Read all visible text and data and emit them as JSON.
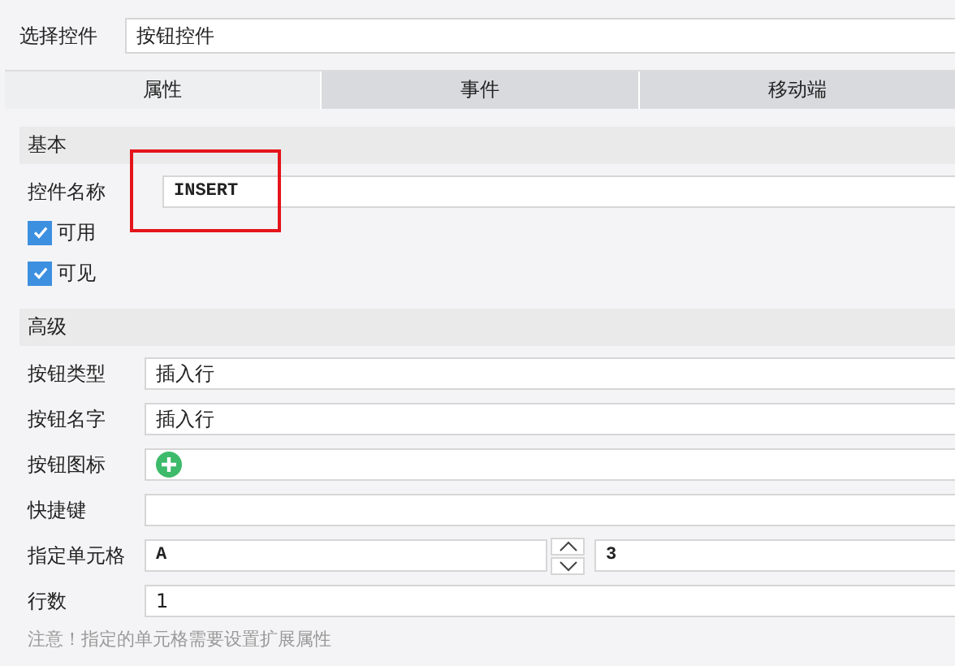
{
  "selector": {
    "label": "选择控件",
    "value": "按钮控件"
  },
  "tabs": [
    {
      "label": "属性",
      "selected": true
    },
    {
      "label": "事件",
      "selected": false
    },
    {
      "label": "移动端",
      "selected": false
    }
  ],
  "sections": [
    {
      "title": "基本",
      "rows": [
        {
          "kind": "text",
          "label": "控件名称",
          "value": "INSERT",
          "highlighted": true,
          "mono": true
        },
        {
          "kind": "checkbox",
          "label": "可用",
          "checked": true
        },
        {
          "kind": "checkbox",
          "label": "可见",
          "checked": true
        }
      ]
    },
    {
      "title": "高级",
      "rows": [
        {
          "kind": "text",
          "label": "按钮类型",
          "value": "插入行"
        },
        {
          "kind": "text",
          "label": "按钮名字",
          "value": "插入行"
        },
        {
          "kind": "icon",
          "label": "按钮图标"
        },
        {
          "kind": "text",
          "label": "快捷键",
          "value": ""
        },
        {
          "kind": "cell",
          "label": "指定单元格",
          "column": "A",
          "row": "3"
        },
        {
          "kind": "text",
          "label": "行数",
          "value": "1"
        }
      ]
    }
  ],
  "note": "注意！指定的单元格需要设置扩展属性"
}
